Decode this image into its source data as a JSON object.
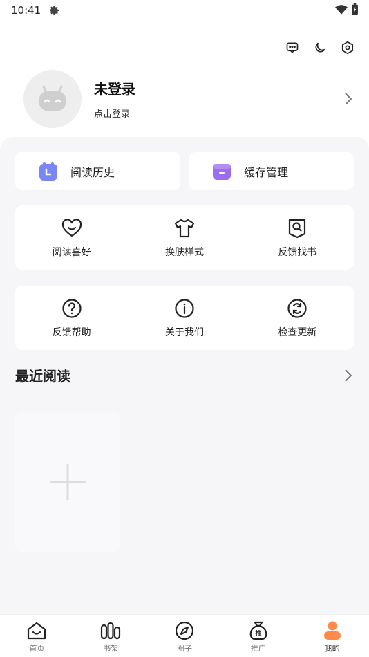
{
  "status": {
    "time": "10:41"
  },
  "profile": {
    "name": "未登录",
    "subtitle": "点击登录"
  },
  "quick": [
    {
      "label": "阅读历史",
      "color": "#7b86f6"
    },
    {
      "label": "缓存管理",
      "color": "#9b6ef0"
    }
  ],
  "grid1": [
    {
      "label": "阅读喜好",
      "icon": "heart-smile-icon"
    },
    {
      "label": "换肤样式",
      "icon": "tshirt-icon"
    },
    {
      "label": "反馈找书",
      "icon": "search-book-icon"
    }
  ],
  "grid2": [
    {
      "label": "反馈帮助",
      "icon": "help-circle-icon"
    },
    {
      "label": "关于我们",
      "icon": "info-circle-icon"
    },
    {
      "label": "检查更新",
      "icon": "refresh-circle-icon"
    }
  ],
  "recent": {
    "title": "最近阅读"
  },
  "nav": [
    {
      "label": "首页",
      "icon": "home-icon"
    },
    {
      "label": "书架",
      "icon": "bookshelf-icon"
    },
    {
      "label": "圈子",
      "icon": "compass-icon"
    },
    {
      "label": "推广",
      "icon": "promo-bag-icon"
    },
    {
      "label": "我的",
      "icon": "user-icon",
      "active": true
    }
  ],
  "colors": {
    "accent": "#ff8a4c",
    "panel": "#f6f6f8"
  }
}
